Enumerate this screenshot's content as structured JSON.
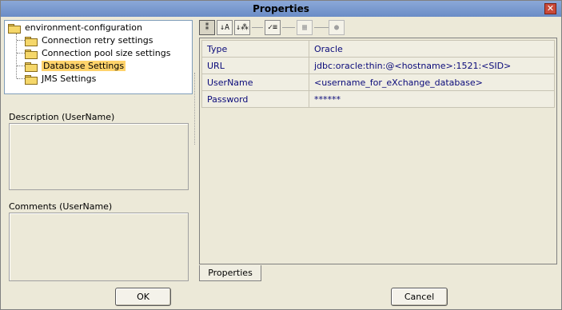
{
  "window": {
    "title": "Properties",
    "close_glyph": "✕"
  },
  "tree": {
    "root": "environment-configuration",
    "children": [
      "Connection retry settings",
      "Connection pool size settings",
      "Database Settings",
      "JMS Settings"
    ],
    "selected": "Database Settings"
  },
  "description": {
    "label": "Description (UserName)",
    "value": ""
  },
  "comments": {
    "label": "Comments (UserName)",
    "value": ""
  },
  "toolbar": {
    "buttons": [
      {
        "icon": "categorized-icon",
        "glyph": "⁑"
      },
      {
        "icon": "sort-az-icon",
        "glyph": "↓A"
      },
      {
        "icon": "sort-category-icon",
        "glyph": "↓⁂"
      },
      {
        "icon": "checklist-icon",
        "glyph": "✓≡"
      },
      {
        "icon": "grid-icon",
        "glyph": "▦"
      },
      {
        "icon": "info-icon",
        "glyph": "●"
      }
    ]
  },
  "properties": [
    {
      "key": "Type",
      "value": "Oracle"
    },
    {
      "key": "URL",
      "value": "jdbc:oracle:thin:@<hostname>:1521:<SID>"
    },
    {
      "key": "UserName",
      "value": "<username_for_eXchange_database>"
    },
    {
      "key": "Password",
      "value": "******"
    }
  ],
  "tabs": {
    "properties": "Properties"
  },
  "buttons": {
    "ok": "OK",
    "cancel": "Cancel"
  }
}
